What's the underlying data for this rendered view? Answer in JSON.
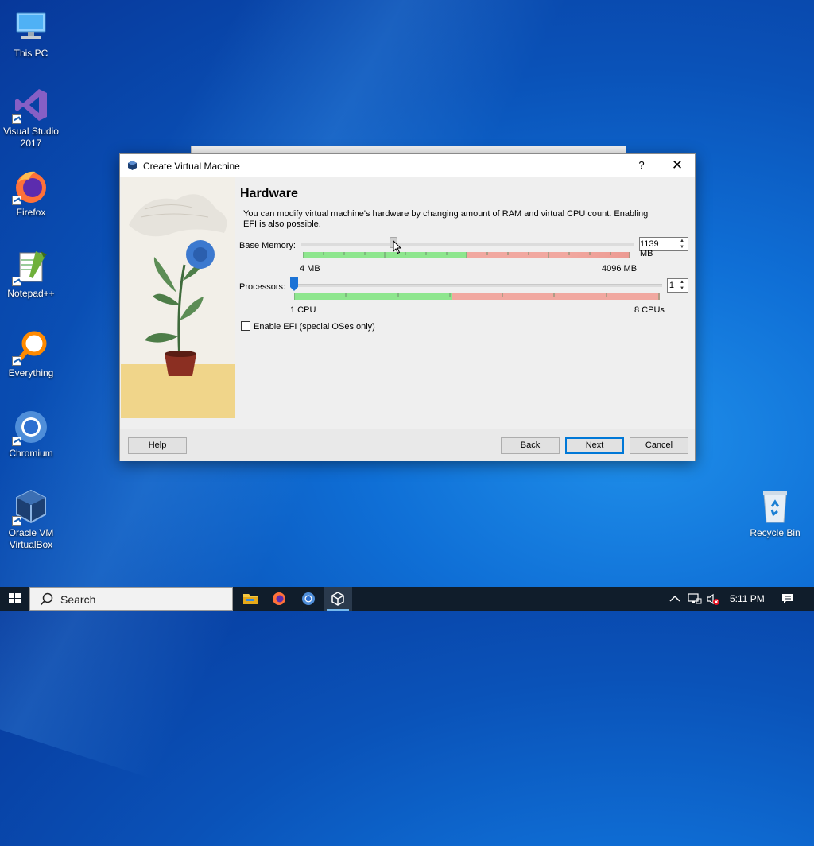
{
  "desktop": {
    "icons": [
      {
        "label": "This PC",
        "icon": "computer-icon"
      },
      {
        "label": "Visual Studio 2017",
        "icon": "visual-studio-icon"
      },
      {
        "label": "Firefox",
        "icon": "firefox-icon"
      },
      {
        "label": "Notepad++",
        "icon": "notepad-plus-plus-icon"
      },
      {
        "label": "Everything",
        "icon": "everything-search-icon"
      },
      {
        "label": "Chromium",
        "icon": "chromium-icon"
      },
      {
        "label": "Oracle VM VirtualBox",
        "icon": "virtualbox-icon"
      },
      {
        "label": "Recycle Bin",
        "icon": "recycle-bin-icon"
      }
    ]
  },
  "dialog": {
    "title": "Create Virtual Machine",
    "help_glyph": "?",
    "close_glyph": "✕",
    "heading": "Hardware",
    "description": "You can modify virtual machine's hardware by changing amount of RAM and virtual CPU count. Enabling EFI is also possible.",
    "memory": {
      "label": "Base Memory:",
      "value": "1139 MB",
      "min_label": "4 MB",
      "max_label": "4096 MB",
      "min": 4,
      "max": 4096,
      "current": 1139
    },
    "processors": {
      "label": "Processors:",
      "value": "1",
      "min_label": "1 CPU",
      "max_label": "8 CPUs",
      "min": 1,
      "max": 8,
      "current": 1
    },
    "efi": {
      "label": "Enable EFI (special OSes only)",
      "checked": false
    },
    "buttons": {
      "help": "Help",
      "back": "Back",
      "next": "Next",
      "cancel": "Cancel"
    }
  },
  "taskbar": {
    "search_placeholder": "Search",
    "apps": [
      "file-explorer-icon",
      "firefox-icon",
      "chromium-icon",
      "virtualbox-icon"
    ],
    "clock": "5:11 PM"
  },
  "colors": {
    "accent": "#0078d7",
    "green_zone": "#8ee68e",
    "red_zone": "#f1a8a0"
  }
}
